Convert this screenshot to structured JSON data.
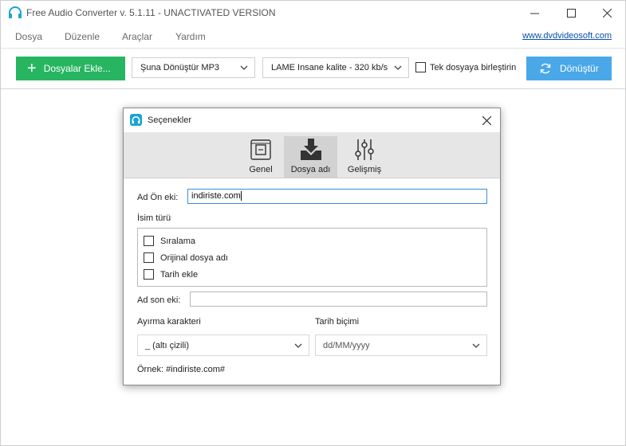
{
  "window": {
    "title": "Free Audio Converter v. 5.1.11 - UNACTIVATED VERSION",
    "accent_color": "#1aa3d6"
  },
  "menu": {
    "items": [
      "Dosya",
      "Düzenle",
      "Araçlar",
      "Yardım"
    ],
    "site_link": "www.dvdvideosoft.com"
  },
  "toolbar": {
    "add_files_label": "Dosyalar Ekle...",
    "add_files_color": "#27b561",
    "format_selected": "Şuna Dönüştür MP3",
    "quality_selected": "LAME Insane kalite - 320 kb/s",
    "merge_label": "Tek dosyaya birleştirin",
    "merge_checked": false,
    "convert_label": "Dönüştür",
    "convert_color": "#4aa8e9"
  },
  "dialog": {
    "title": "Seçenekler",
    "tabs": [
      {
        "label": "Genel",
        "icon": "device-icon",
        "active": false
      },
      {
        "label": "Dosya adı",
        "icon": "download-folder-icon",
        "active": true
      },
      {
        "label": "Gelişmiş",
        "icon": "sliders-icon",
        "active": false
      }
    ],
    "prefix_label": "Ad Ön eki:",
    "prefix_value": "indiriste.com",
    "name_type_label": "İsim türü",
    "name_options": [
      {
        "label": "Sıralama",
        "checked": false
      },
      {
        "label": "Orijinal dosya adı",
        "checked": false
      },
      {
        "label": "Tarih ekle",
        "checked": false
      }
    ],
    "suffix_label": "Ad son eki:",
    "suffix_value": "",
    "separator_label": "Ayırma karakteri",
    "separator_selected": "_ (altı çizili)",
    "date_format_label": "Tarih biçimi",
    "date_format_selected": "dd/MM/yyyy",
    "example_text": "Örnek: #indiriste.com#"
  }
}
